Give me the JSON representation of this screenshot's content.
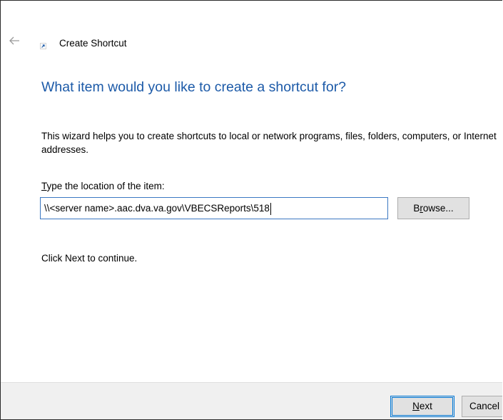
{
  "window": {
    "title": "Create Shortcut",
    "icons": {
      "back": "back-arrow-icon",
      "app": "shortcut-icon"
    }
  },
  "main": {
    "heading": "What item would you like to create a shortcut for?",
    "description": "This wizard helps you to create shortcuts to local or network programs, files, folders, computers, or Internet addresses.",
    "location_label_accesskey": "T",
    "location_label_rest": "ype the location of the item:",
    "location_value": "\\\\<server name>.aac.dva.va.gov\\VBECSReports\\518",
    "browse_accesskey": "r",
    "browse_pre": "B",
    "browse_post": "owse...",
    "continue_text": "Click Next to continue."
  },
  "footer": {
    "next_accesskey": "N",
    "next_rest": "ext",
    "cancel_label": "Cancel"
  },
  "colors": {
    "heading": "#1c5aa8",
    "accent": "#0078d7",
    "footer_bg": "#f0f0f0"
  }
}
